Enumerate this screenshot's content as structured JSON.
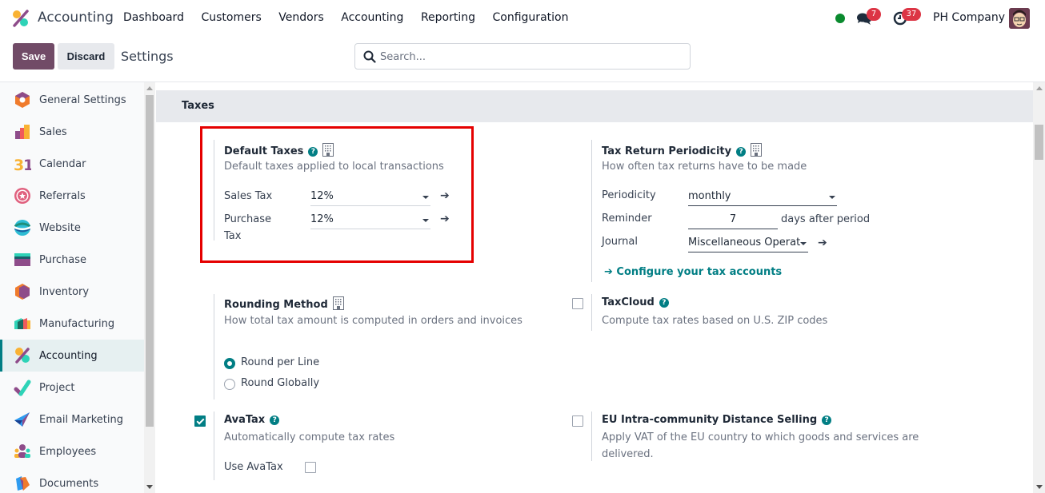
{
  "navbar": {
    "app_name": "Accounting",
    "menu": [
      "Dashboard",
      "Customers",
      "Vendors",
      "Accounting",
      "Reporting",
      "Configuration"
    ],
    "messages_count": "7",
    "activities_count": "37",
    "company": "PH Company",
    "status_color": "#0a8a2e"
  },
  "control_panel": {
    "save_label": "Save",
    "discard_label": "Discard",
    "title": "Settings",
    "search_placeholder": "Search..."
  },
  "sidebar": {
    "items": [
      {
        "label": "General Settings",
        "icon": "general-settings-icon"
      },
      {
        "label": "Sales",
        "icon": "sales-icon"
      },
      {
        "label": "Calendar",
        "icon": "calendar-icon"
      },
      {
        "label": "Referrals",
        "icon": "referrals-icon"
      },
      {
        "label": "Website",
        "icon": "website-icon"
      },
      {
        "label": "Purchase",
        "icon": "purchase-icon"
      },
      {
        "label": "Inventory",
        "icon": "inventory-icon"
      },
      {
        "label": "Manufacturing",
        "icon": "manufacturing-icon"
      },
      {
        "label": "Accounting",
        "icon": "accounting-icon",
        "active": true
      },
      {
        "label": "Project",
        "icon": "project-icon"
      },
      {
        "label": "Email Marketing",
        "icon": "email-marketing-icon"
      },
      {
        "label": "Employees",
        "icon": "employees-icon"
      },
      {
        "label": "Documents",
        "icon": "documents-icon"
      }
    ]
  },
  "section": {
    "title": "Taxes"
  },
  "default_taxes": {
    "title": "Default Taxes",
    "description": "Default taxes applied to local transactions",
    "sales_tax_label": "Sales Tax",
    "sales_tax_value": "12%",
    "purchase_tax_label_1": "Purchase",
    "purchase_tax_label_2": "Tax",
    "purchase_tax_value": "12%"
  },
  "tax_return": {
    "title": "Tax Return Periodicity",
    "description": "How often tax returns have to be made",
    "periodicity_label": "Periodicity",
    "periodicity_value": "monthly",
    "reminder_label": "Reminder",
    "reminder_value": "7",
    "reminder_suffix": "days after period",
    "journal_label": "Journal",
    "journal_value": "Miscellaneous Operat",
    "configure_link": "Configure your tax accounts"
  },
  "rounding": {
    "title": "Rounding Method",
    "description": "How total tax amount is computed in orders and invoices",
    "options": [
      "Round per Line",
      "Round Globally"
    ],
    "selected": "Round per Line"
  },
  "taxcloud": {
    "title": "TaxCloud",
    "description": "Compute tax rates based on U.S. ZIP codes",
    "checked": false
  },
  "avatax": {
    "title": "AvaTax",
    "description": "Automatically compute tax rates",
    "checked": true,
    "use_label": "Use AvaTax",
    "use_checked": false
  },
  "eu_distance": {
    "title": "EU Intra-community Distance Selling",
    "description_1": "Apply VAT of the EU country to which goods and services are",
    "description_2": "delivered.",
    "checked": false
  },
  "colors": {
    "primary": "#714b67",
    "accent": "#017e84",
    "highlight_box": "#e50000"
  }
}
